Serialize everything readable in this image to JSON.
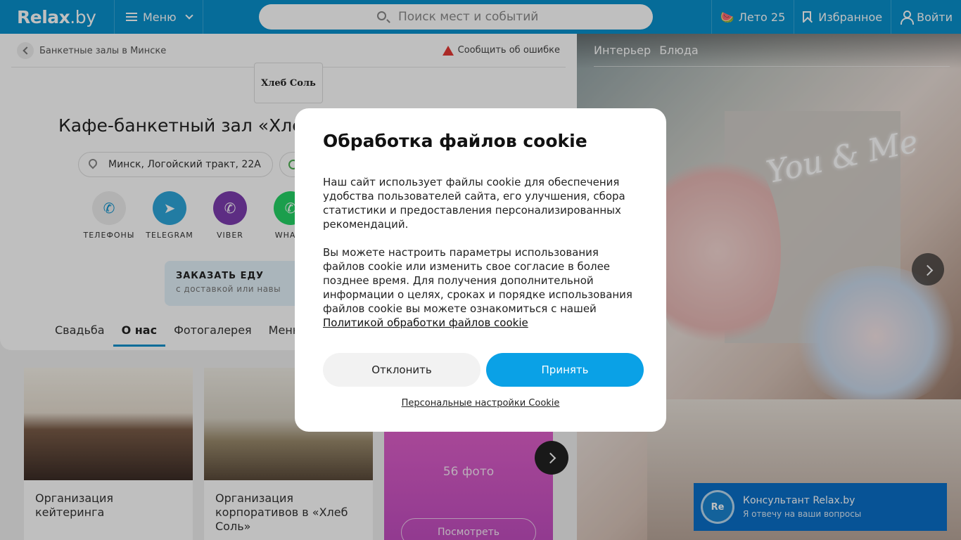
{
  "header": {
    "logo_main": "Relax",
    "logo_suffix": ".by",
    "menu_label": "Меню",
    "search_placeholder": "Поиск мест и событий",
    "summer_label": "Лето 25",
    "favorites_label": "Избранное",
    "login_label": "Войти"
  },
  "breadcrumb": {
    "label": "Банкетные залы в Минске"
  },
  "report_label": "Сообщить об ошибке",
  "brand_logo": {
    "name": "Хлеб Соль"
  },
  "venue": {
    "title": "Кафе-банкетный зал «Хлеб",
    "address": "Минск, Логойский тракт, 22А"
  },
  "contacts": [
    {
      "label": "ТЕЛЕФОНЫ",
      "icon": "phone-icon",
      "color": "#eeeeee"
    },
    {
      "label": "TELEGRAM",
      "icon": "telegram-icon",
      "color": "#2ea6da"
    },
    {
      "label": "VIBER",
      "icon": "viber-icon",
      "color": "#7d3daf"
    },
    {
      "label": "WHATS",
      "icon": "whatsapp-icon",
      "color": "#25d366"
    }
  ],
  "order_food": {
    "title": "ЗАКАЗАТЬ ЕДУ",
    "subtitle": "с доставкой или навы"
  },
  "tabs": [
    "Свадьба",
    "О нас",
    "Фотогалерея",
    "Меню"
  ],
  "cards": [
    {
      "title": "Организация кейтеринга"
    },
    {
      "title": "Организация корпоративов в «Хлеб Соль»"
    }
  ],
  "photos_card": {
    "count": "56 фото",
    "view_label": "Посмотреть"
  },
  "gallery": {
    "tabs": [
      "Интерьер",
      "Блюда"
    ]
  },
  "consultant": {
    "avatar": "Re",
    "title": "Консультант Relax.by",
    "subtitle": "Я отвечу на ваши вопросы"
  },
  "cookie_modal": {
    "title": "Обработка файлов cookie",
    "paragraph1": "Наш сайт использует файлы cookie для обеспечения удобства пользователей сайта, его улучшения, сбора статистики и предоставления персонализированных рекомендаций.",
    "paragraph2": "Вы можете настроить параметры использования файлов cookie или изменить свое согласие в более позднее время. Для получения дополнительной информации о целях, сроках и порядке использования файлов cookie вы можете ознакомиться с нашей",
    "policy_link": "Политикой обработки файлов cookie",
    "decline_label": "Отклонить",
    "accept_label": "Принять",
    "personal_settings": "Персональные настройки Cookie"
  },
  "colors": {
    "brand": "#0891cd",
    "accent": "#0aa1e6",
    "consultant": "#0a6fc9"
  }
}
